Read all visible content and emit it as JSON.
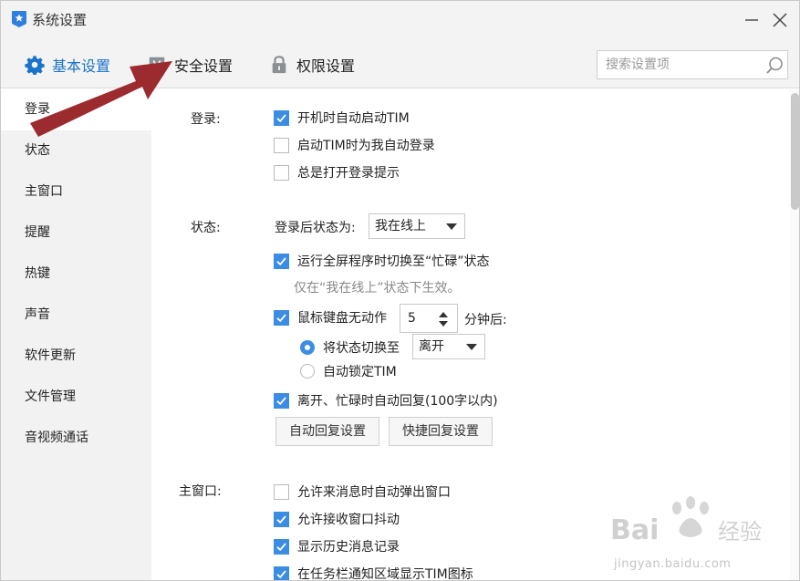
{
  "window": {
    "title": "系统设置",
    "minimize_icon": "minimize-icon",
    "close_icon": "close-icon"
  },
  "tabs": [
    {
      "label": "基本设置",
      "icon": "gear-icon",
      "active": true
    },
    {
      "label": "安全设置",
      "icon": "shield-icon",
      "active": false
    },
    {
      "label": "权限设置",
      "icon": "lock-icon",
      "active": false
    }
  ],
  "search": {
    "placeholder": "搜索设置项",
    "icon": "search-icon"
  },
  "sidebar": {
    "items": [
      {
        "label": "登录",
        "active": true
      },
      {
        "label": "状态"
      },
      {
        "label": "主窗口"
      },
      {
        "label": "提醒"
      },
      {
        "label": "热键"
      },
      {
        "label": "声音"
      },
      {
        "label": "软件更新"
      },
      {
        "label": "文件管理"
      },
      {
        "label": "音视频通话"
      }
    ]
  },
  "login": {
    "section_label": "登录:",
    "options": [
      {
        "label": "开机时自动启动TIM",
        "checked": true
      },
      {
        "label": "启动TIM时为我自动登录",
        "checked": false
      },
      {
        "label": "总是打开登录提示",
        "checked": false
      }
    ]
  },
  "status": {
    "section_label": "状态:",
    "after_login_label": "登录后状态为:",
    "after_login_value": "我在线上",
    "fullscreen_label": "运行全屏程序时切换至“忙碌”状态",
    "fullscreen_checked": true,
    "fullscreen_hint": "仅在“我在线上”状态下生效。",
    "idle_label": "鼠标键盘无动作",
    "idle_minutes": "5",
    "idle_suffix": "分钟后:",
    "idle_checked": true,
    "switch_label": "将状态切换至",
    "switch_value": "离开",
    "switch_selected": true,
    "lock_label": "自动锁定TIM",
    "lock_selected": false,
    "autoreply_label": "离开、忙碌时自动回复(100字以内)",
    "autoreply_checked": true,
    "autoreply_button": "自动回复设置",
    "quickreply_button": "快捷回复设置"
  },
  "mainwindow": {
    "section_label": "主窗口:",
    "options": [
      {
        "label": "允许来消息时自动弹出窗口",
        "checked": false
      },
      {
        "label": "允许接收窗口抖动",
        "checked": true
      },
      {
        "label": "显示历史消息记录",
        "checked": true
      },
      {
        "label": "在任务栏通知区域显示TIM图标",
        "checked": true
      }
    ]
  },
  "colors": {
    "accent": "#3b8de3",
    "active_tab": "#1a74c9",
    "annotation_arrow": "#9b2b2e"
  },
  "watermark": {
    "logo": "Bai度经验",
    "url": "jingyan.baidu.com"
  }
}
